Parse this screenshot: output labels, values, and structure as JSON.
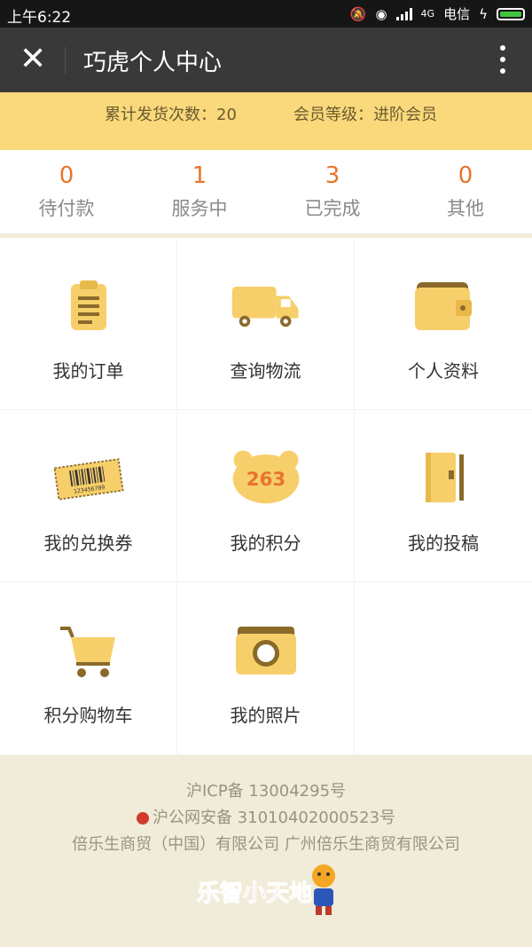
{
  "status_bar": {
    "time": "上午6:22",
    "network": "4G",
    "carrier": "电信",
    "battery_color": "#3fc43f"
  },
  "title_bar": {
    "close_icon": "close-icon",
    "title": "巧虎个人中心",
    "more_icon": "more-vertical-icon"
  },
  "summary": {
    "shipments": "累计发货次数：20",
    "level": "会员等级：进阶会员",
    "background": "#f9d97b"
  },
  "orders": [
    {
      "count": "0",
      "label": "待付款"
    },
    {
      "count": "1",
      "label": "服务中"
    },
    {
      "count": "3",
      "label": "已完成"
    },
    {
      "count": "0",
      "label": "其他"
    }
  ],
  "menu": [
    {
      "label": "我的订单",
      "icon": "clipboard-icon"
    },
    {
      "label": "查询物流",
      "icon": "truck-icon"
    },
    {
      "label": "个人资料",
      "icon": "wallet-icon"
    },
    {
      "label": "我的兑换券",
      "icon": "ticket-icon",
      "ticket_code": "123456789"
    },
    {
      "label": "我的积分",
      "icon": "bear-points-icon",
      "points": "263"
    },
    {
      "label": "我的投稿",
      "icon": "notebook-icon"
    },
    {
      "label": "积分购物车",
      "icon": "cart-icon"
    },
    {
      "label": "我的照片",
      "icon": "camera-icon"
    }
  ],
  "footer": {
    "icp": "沪ICP备 13004295号",
    "police": "沪公网安备 31010402000523号",
    "company": "倍乐生商贸（中国）有限公司 广州倍乐生商贸有限公司",
    "logo_text": "乐智小天地"
  },
  "accent_color": "#e8742b",
  "icon_color": "#f7cf6a"
}
